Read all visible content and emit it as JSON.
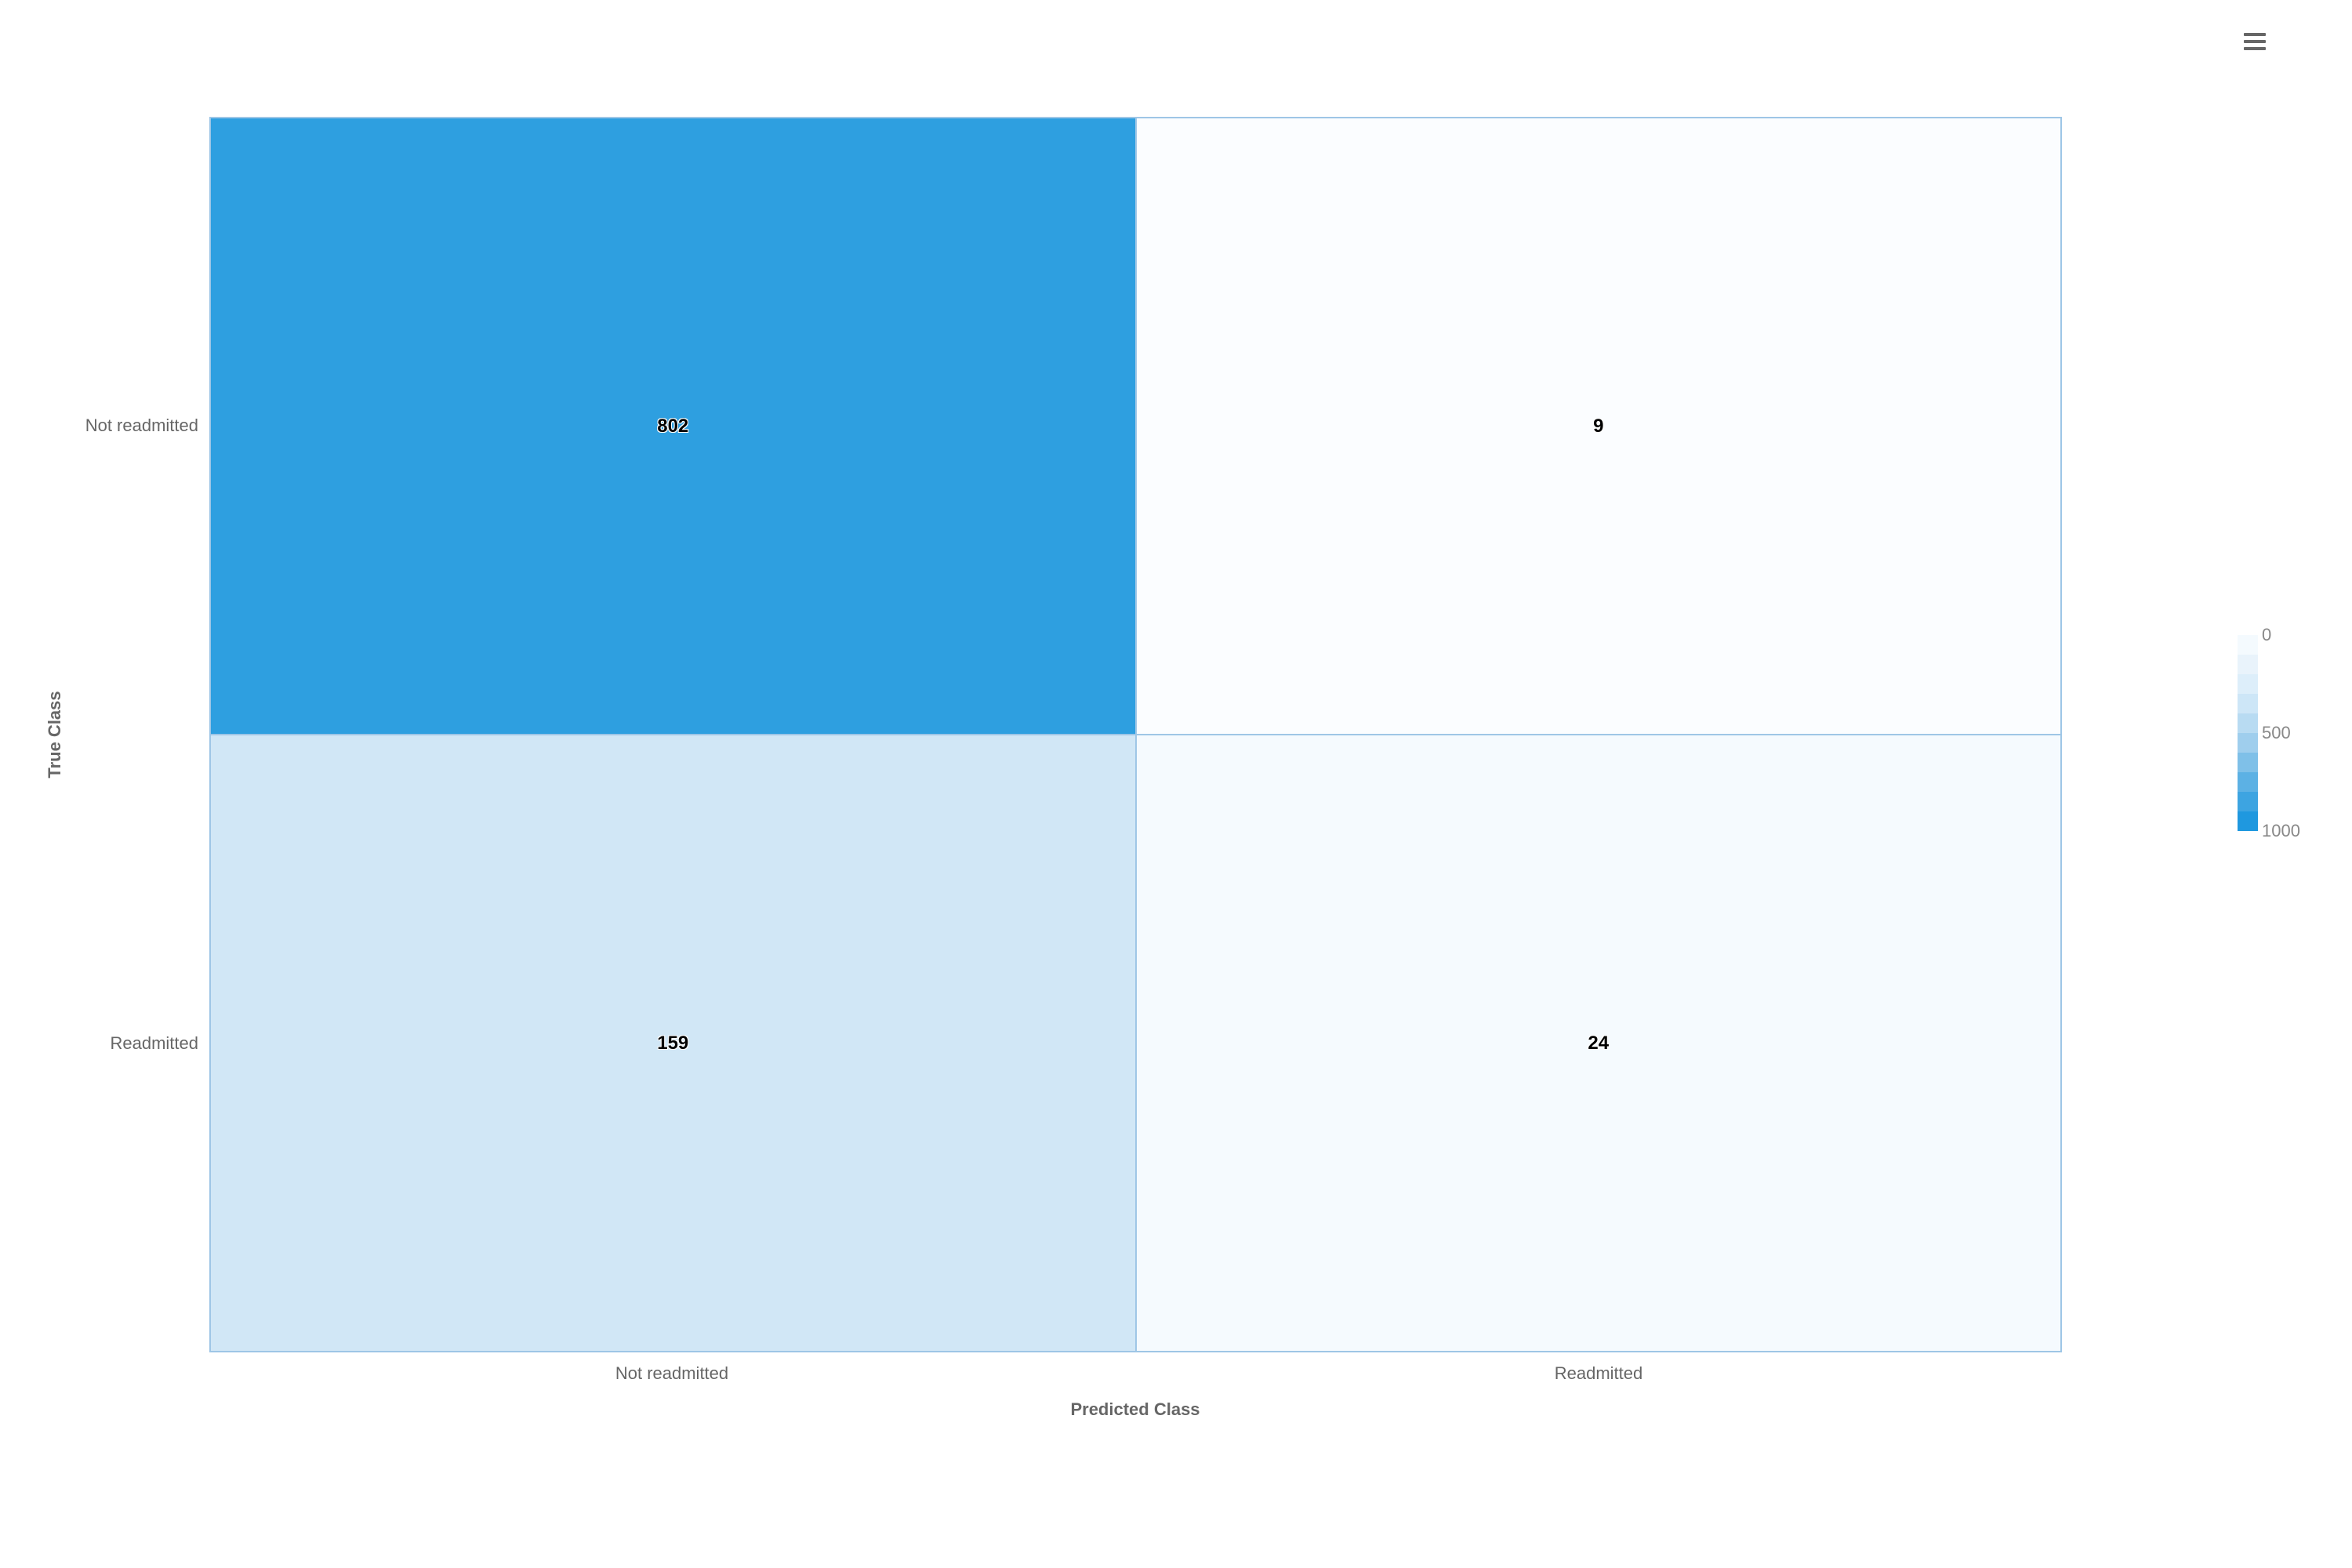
{
  "chart_data": {
    "type": "heatmap",
    "xlabel": "Predicted Class",
    "ylabel": "True Class",
    "x_categories": [
      "Not readmitted",
      "Readmitted"
    ],
    "y_categories": [
      "Not readmitted",
      "Readmitted"
    ],
    "matrix": [
      [
        802,
        9
      ],
      [
        159,
        24
      ]
    ],
    "color_scale": {
      "min": 0,
      "max": 1000,
      "ticks": [
        0,
        500,
        1000
      ]
    }
  },
  "cells": {
    "r0c0": {
      "value": "802",
      "bg": "#2e9fe0"
    },
    "r0c1": {
      "value": "9",
      "bg": "#fbfdff"
    },
    "r1c0": {
      "value": "159",
      "bg": "#d1e7f6"
    },
    "r1c1": {
      "value": "24",
      "bg": "#f5fafe"
    }
  },
  "axes": {
    "ylabel": "True Class",
    "xlabel": "Predicted Class",
    "ytick0": "Not readmitted",
    "ytick1": "Readmitted",
    "xtick0": "Not readmitted",
    "xtick1": "Readmitted"
  },
  "colorbar": {
    "t0": "0",
    "t1": "500",
    "t2": "1000"
  }
}
